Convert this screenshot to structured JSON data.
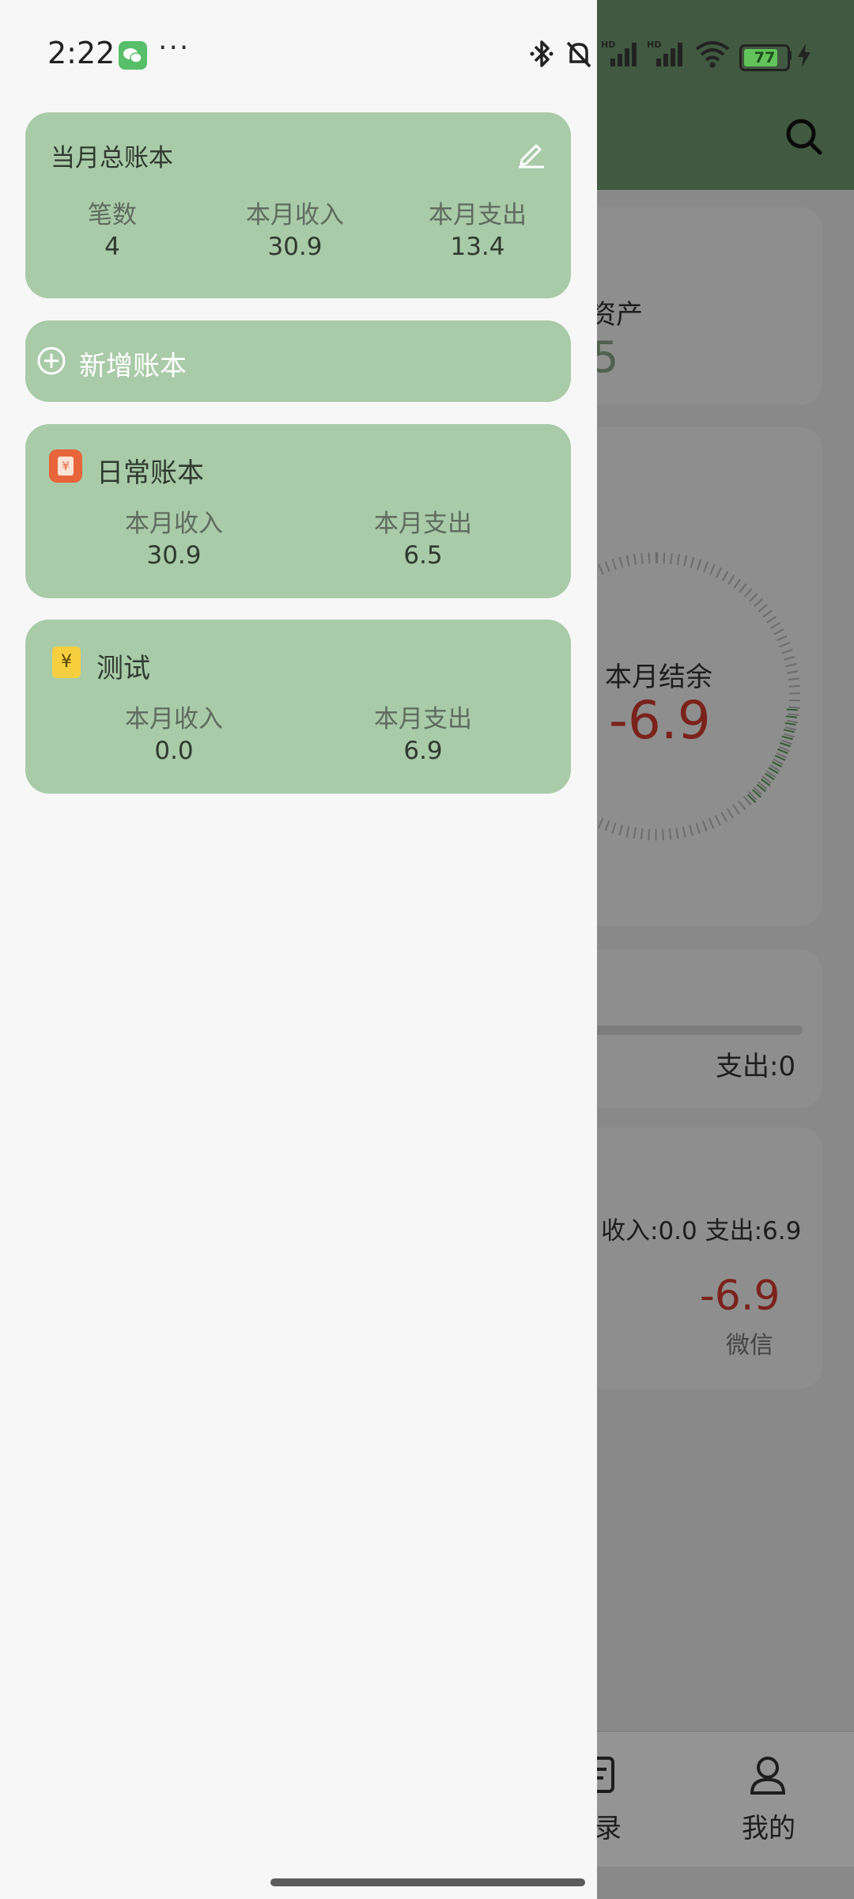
{
  "status_bar": {
    "time": "2:22",
    "more": "···",
    "battery_level": "77"
  },
  "summary_card": {
    "title": "当月总账本",
    "stats": [
      {
        "label": "笔数",
        "value": "4"
      },
      {
        "label": "本月收入",
        "value": "30.9"
      },
      {
        "label": "本月支出",
        "value": "13.4"
      }
    ]
  },
  "add_book": {
    "label": "新增账本"
  },
  "books": [
    {
      "name": "日常账本",
      "icon_color": "#e8643a",
      "income_label": "本月收入",
      "income": "30.9",
      "expense_label": "本月支出",
      "expense": "6.5"
    },
    {
      "name": "测试",
      "icon_color": "#f5cf3f",
      "icon_glyph": "¥",
      "income_label": "本月收入",
      "income": "0.0",
      "expense_label": "本月支出",
      "expense": "6.9"
    }
  ],
  "background": {
    "assets_label": "资产",
    "assets_value": "5",
    "balance_label": "本月结余",
    "balance_value": "-6.9",
    "expense_zero": "支出:0",
    "income_expense_line": "收入:0.0  支出:6.9",
    "tx_amount": "-6.9",
    "tx_source": "微信",
    "nav_records": "录",
    "nav_mine": "我的"
  },
  "colors": {
    "card_green": "#a9cba8",
    "header_green": "#6f9a6f",
    "negative_red": "#d23b2f"
  }
}
